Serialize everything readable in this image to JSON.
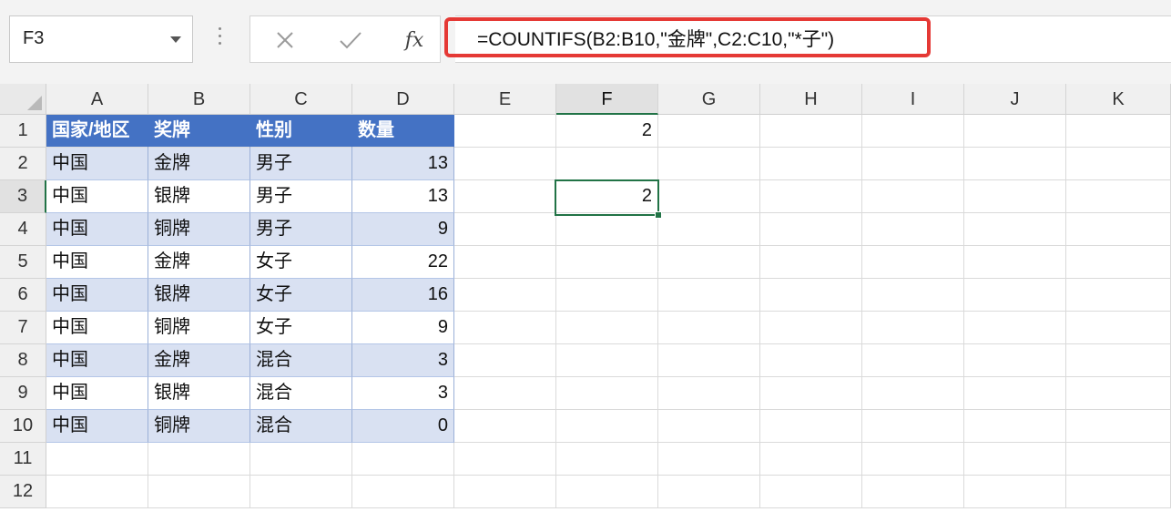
{
  "name_box": {
    "value": "F3"
  },
  "formula_bar": {
    "cancel_icon": "x-icon",
    "enter_icon": "check-icon",
    "fx_label": "fx",
    "formula": "=COUNTIFS(B2:B10,\"金牌\",C2:C10,\"*子\")",
    "highlight_color": "#e53935"
  },
  "columns": [
    "A",
    "B",
    "C",
    "D",
    "E",
    "F",
    "G",
    "H",
    "I",
    "J",
    "K"
  ],
  "rows": [
    "1",
    "2",
    "3",
    "4",
    "5",
    "6",
    "7",
    "8",
    "9",
    "10",
    "11",
    "12"
  ],
  "selected": {
    "column": "F",
    "row": "3"
  },
  "table": {
    "headers": [
      "国家/地区",
      "奖牌",
      "性别",
      "数量"
    ],
    "records": [
      [
        "中国",
        "金牌",
        "男子",
        "13"
      ],
      [
        "中国",
        "银牌",
        "男子",
        "13"
      ],
      [
        "中国",
        "铜牌",
        "男子",
        "9"
      ],
      [
        "中国",
        "金牌",
        "女子",
        "22"
      ],
      [
        "中国",
        "银牌",
        "女子",
        "16"
      ],
      [
        "中国",
        "铜牌",
        "女子",
        "9"
      ],
      [
        "中国",
        "金牌",
        "混合",
        "3"
      ],
      [
        "中国",
        "银牌",
        "混合",
        "3"
      ],
      [
        "中国",
        "铜牌",
        "混合",
        "0"
      ]
    ],
    "header_color": "#4472c4",
    "band_color": "#d9e1f2"
  },
  "other_cells": {
    "F1": "2",
    "F3": "2"
  },
  "accent_color": "#217346"
}
